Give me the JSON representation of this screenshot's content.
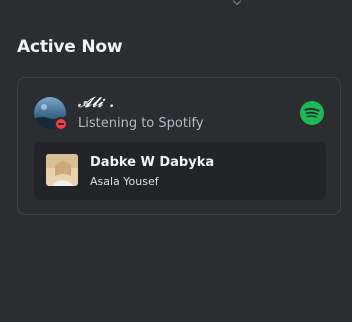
{
  "section": {
    "title": "Active Now"
  },
  "user": {
    "name": "𝒜𝓁𝒾 .",
    "status": "do-not-disturb",
    "activity": "Listening to Spotify"
  },
  "track": {
    "title": "Dabke W Dabyka",
    "artist": "Asala Yousef"
  },
  "colors": {
    "background": "#2b2d31",
    "card_border": "#3f4147",
    "track_bg": "#232428",
    "spotify_green": "#1db954",
    "dnd_red": "#f23f43",
    "secondary_text": "#b5bac1"
  },
  "icons": {
    "app": "spotify-icon",
    "status": "do-not-disturb-icon"
  }
}
